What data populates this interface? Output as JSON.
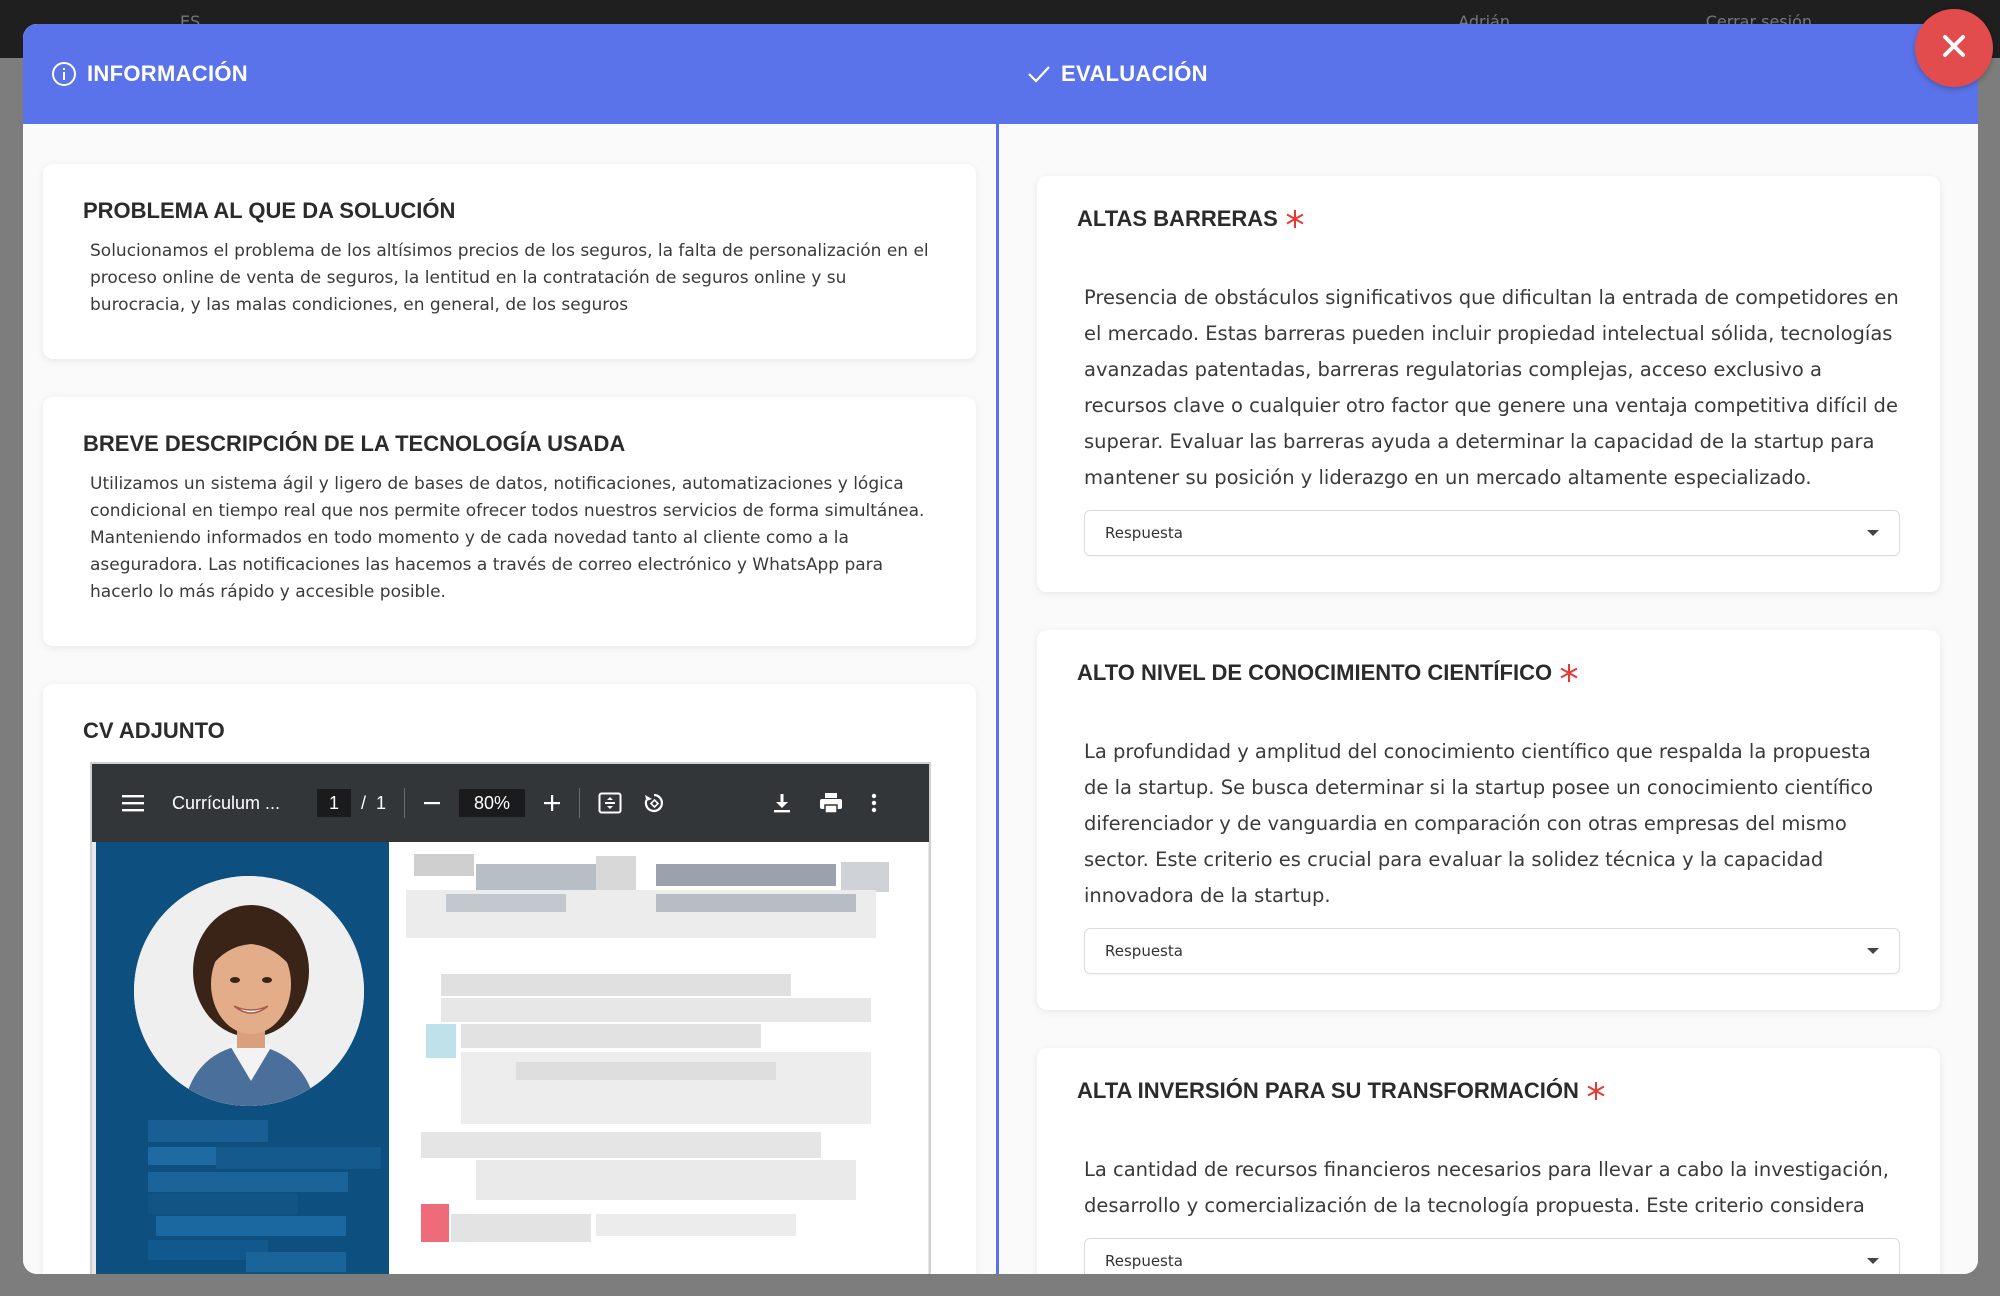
{
  "backdrop": {
    "language": "ES",
    "user": "Adrián",
    "logout": "Cerrar sesión"
  },
  "info_panel": {
    "header": "INFORMACIÓN",
    "icon": "info-circle-icon",
    "sections": [
      {
        "title": "PROBLEMA AL QUE DA SOLUCIÓN",
        "text": "Solucionamos el problema de los altísimos precios de los seguros, la falta de personalización en el proceso online de venta de seguros, la lentitud en la contratación de seguros online y su burocracia, y las malas condiciones, en general, de los seguros"
      },
      {
        "title": "BREVE DESCRIPCIÓN DE LA TECNOLOGÍA USADA",
        "text": "Utilizamos un sistema ágil y ligero de bases de datos, notificaciones, automatizaciones y lógica condicional en tiempo real que nos permite ofrecer todos nuestros servicios de forma simultánea. Manteniendo informados en todo momento y de cada novedad tanto al cliente como a la aseguradora. Las notificaciones las hacemos a través de correo electrónico y WhatsApp para hacerlo lo más rápido y accesible posible."
      }
    ],
    "cv": {
      "title": "CV ADJUNTO",
      "viewer": {
        "doc_title": "Currículum ...",
        "page_current": "1",
        "page_separator": "/",
        "page_total": "1",
        "zoom": "80%"
      }
    }
  },
  "eval_panel": {
    "header": "EVALUACIÓN",
    "icon": "check-icon",
    "required_color": "#e53935",
    "criteria": [
      {
        "title": "ALTAS BARRERAS",
        "description": "Presencia de obstáculos significativos que dificultan la entrada de competidores en el mercado. Estas barreras pueden incluir propiedad intelectual sólida, tecnologías avanzadas patentadas, barreras regulatorias complejas, acceso exclusivo a recursos clave o cualquier otro factor que genere una ventaja competitiva difícil de superar. Evaluar las barreras ayuda a determinar la capacidad de la startup para mantener su posición y liderazgo en un mercado altamente especializado.",
        "select_value": "Respuesta"
      },
      {
        "title": "ALTO NIVEL DE CONOCIMIENTO CIENTÍFICO",
        "description": "La profundidad y amplitud del conocimiento científico que respalda la propuesta de la startup. Se busca determinar si la startup posee un conocimiento científico diferenciador y de vanguardia en comparación con otras empresas del mismo sector. Este criterio es crucial para evaluar la solidez técnica y la capacidad innovadora de la startup.",
        "select_value": "Respuesta"
      },
      {
        "title": "ALTA INVERSIÓN PARA SU TRANSFORMACIÓN",
        "description": "La cantidad de recursos financieros necesarios para llevar a cabo la investigación, desarrollo y comercialización de la tecnología propuesta. Este criterio considera",
        "select_value": "Respuesta"
      }
    ]
  },
  "colors": {
    "header_bg": "#5b73ea",
    "close_bg": "#e34c4c",
    "cv_sidebar": "#0d4f7e"
  }
}
